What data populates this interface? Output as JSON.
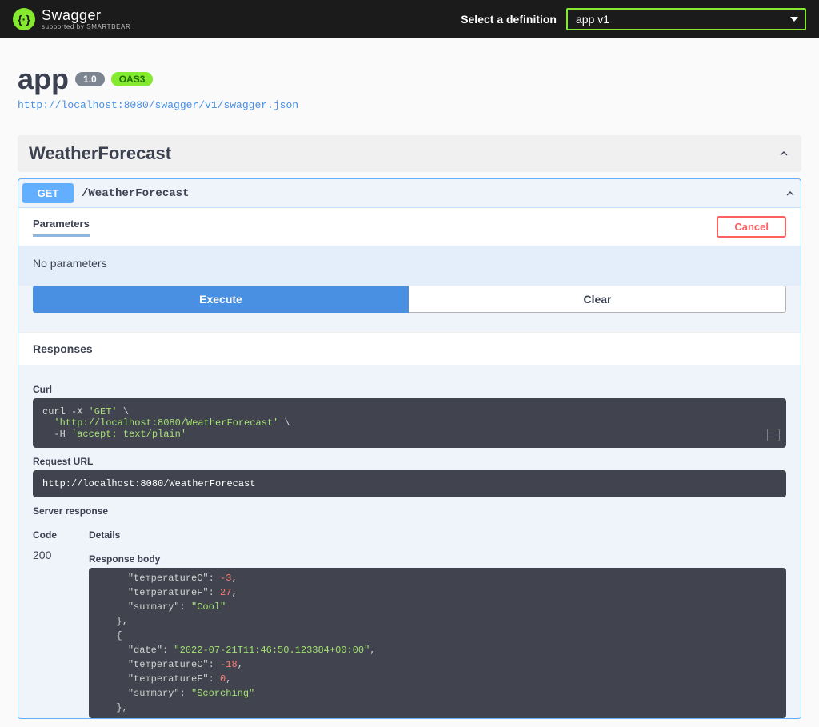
{
  "topbar": {
    "brand": "Swagger",
    "sub": "supported by SMARTBEAR",
    "select_label": "Select a definition",
    "definition": "app v1"
  },
  "info": {
    "title": "app",
    "version": "1.0",
    "oas": "OAS3",
    "swagger_url": "http://localhost:8080/swagger/v1/swagger.json"
  },
  "tag": {
    "name": "WeatherForecast"
  },
  "op": {
    "method": "GET",
    "path": "/WeatherForecast",
    "params_tab": "Parameters",
    "cancel": "Cancel",
    "no_params": "No parameters",
    "execute": "Execute",
    "clear": "Clear",
    "responses_header": "Responses"
  },
  "results": {
    "curl_label": "Curl",
    "curl_cmd": "curl -X ",
    "curl_method": "'GET'",
    "curl_cont": " \\",
    "curl_url": "'http://localhost:8080/WeatherForecast'",
    "curl_hdr_flag": "-H ",
    "curl_hdr": "'accept: text/plain'",
    "request_url_label": "Request URL",
    "request_url": "http://localhost:8080/WeatherForecast",
    "server_resp_label": "Server response",
    "code_header": "Code",
    "details_header": "Details",
    "code": "200",
    "response_body_label": "Response body",
    "json_lines": [
      {
        "indent": 2,
        "key": "\"temperatureC\"",
        "sep": ": ",
        "val": "-3",
        "cls": "tok-num",
        "tail": ","
      },
      {
        "indent": 2,
        "key": "\"temperatureF\"",
        "sep": ": ",
        "val": "27",
        "cls": "tok-num",
        "tail": ","
      },
      {
        "indent": 2,
        "key": "\"summary\"",
        "sep": ": ",
        "val": "\"Cool\"",
        "cls": "tok-str",
        "tail": ""
      },
      {
        "indent": 1,
        "raw": "},"
      },
      {
        "indent": 1,
        "raw": "{"
      },
      {
        "indent": 2,
        "key": "\"date\"",
        "sep": ": ",
        "val": "\"2022-07-21T11:46:50.123384+00:00\"",
        "cls": "tok-str",
        "tail": ","
      },
      {
        "indent": 2,
        "key": "\"temperatureC\"",
        "sep": ": ",
        "val": "-18",
        "cls": "tok-num",
        "tail": ","
      },
      {
        "indent": 2,
        "key": "\"temperatureF\"",
        "sep": ": ",
        "val": "0",
        "cls": "tok-num",
        "tail": ","
      },
      {
        "indent": 2,
        "key": "\"summary\"",
        "sep": ": ",
        "val": "\"Scorching\"",
        "cls": "tok-str",
        "tail": ""
      },
      {
        "indent": 1,
        "raw": "},"
      }
    ]
  }
}
